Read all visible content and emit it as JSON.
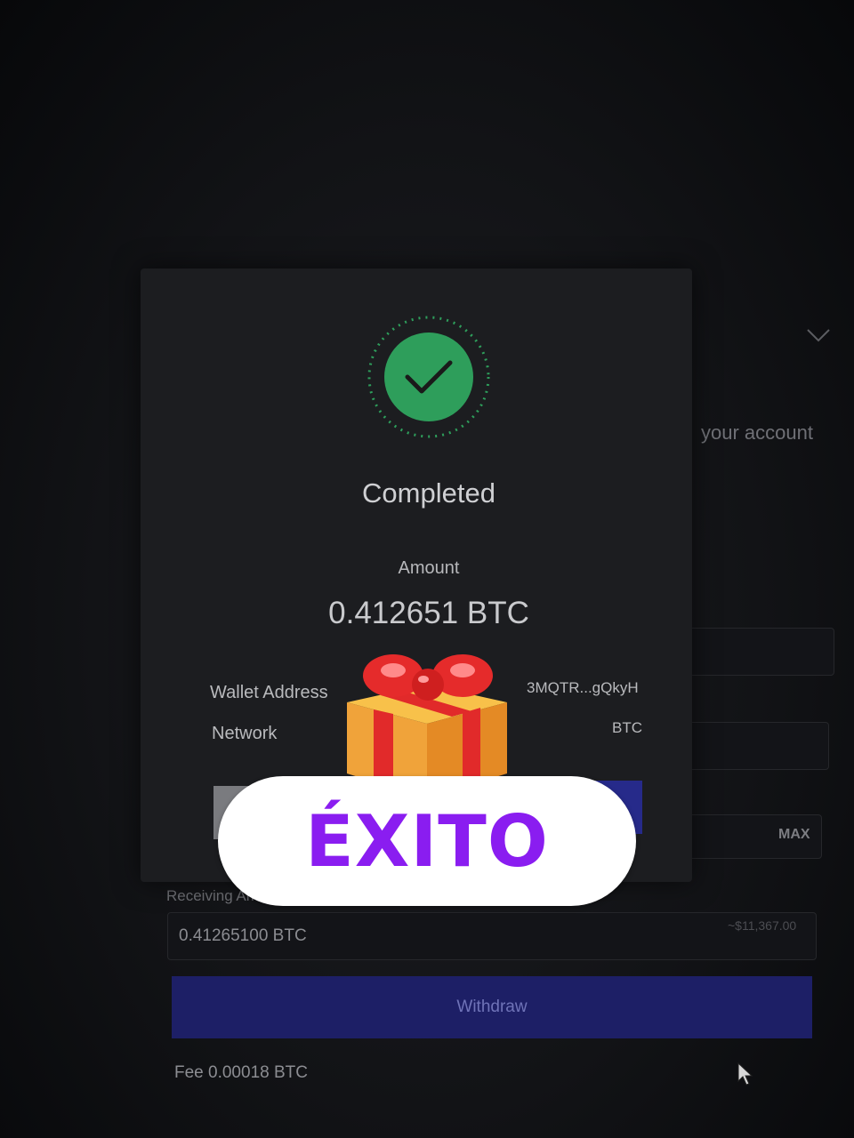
{
  "background_page": {
    "account_text": "your account",
    "max_label": "MAX",
    "receiving_amount_label": "Receiving Amount",
    "receiving_amount_value": "0.41265100 BTC",
    "receiving_amount_usd": "~$11,367.00",
    "withdraw_label": "Withdraw",
    "fee_text": "Fee 0.00018 BTC"
  },
  "modal": {
    "status_title": "Completed",
    "amount_label": "Amount",
    "amount_value": "0.412651 BTC",
    "wallet_address_label": "Wallet Address",
    "wallet_address_value": "3MQTR...gQkyH",
    "network_label": "Network",
    "network_value": "BTC"
  },
  "overlay": {
    "sticker_icon": "gift-icon",
    "sticker_text": "ÉXITO"
  },
  "colors": {
    "success_green": "#2e9e5b",
    "accent_purple": "#8a1df0",
    "button_blue": "#262a8a"
  }
}
